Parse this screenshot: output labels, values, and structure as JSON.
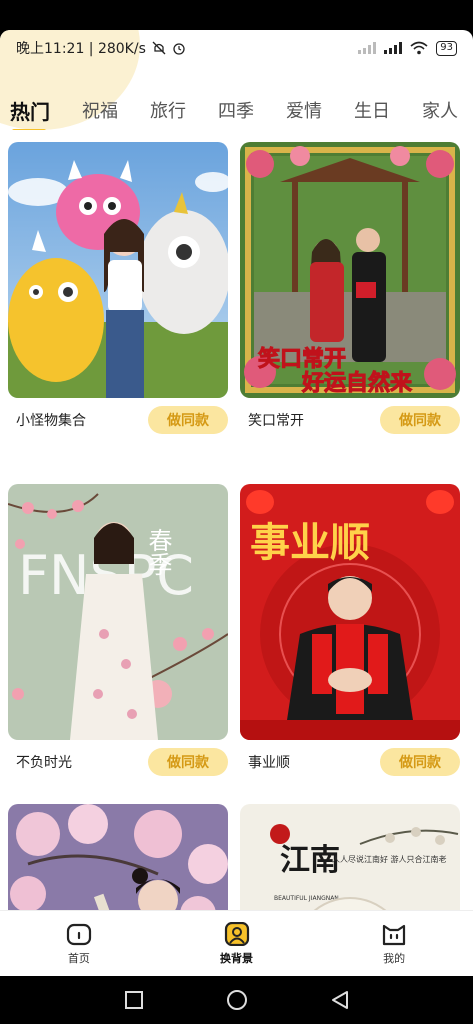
{
  "status_bar": {
    "time_speed": "晚上11:21 | 280K/s",
    "battery": "93"
  },
  "tabs": [
    {
      "label": "热门",
      "active": true
    },
    {
      "label": "祝福",
      "active": false
    },
    {
      "label": "旅行",
      "active": false
    },
    {
      "label": "四季",
      "active": false
    },
    {
      "label": "爱情",
      "active": false
    },
    {
      "label": "生日",
      "active": false
    },
    {
      "label": "家人",
      "active": false
    }
  ],
  "cards": [
    {
      "title": "小怪物集合",
      "button": "做同款"
    },
    {
      "title": "笑口常开",
      "button": "做同款",
      "overlay_line1": "笑口常开",
      "overlay_line2": "好运自然来"
    },
    {
      "title": "不负时光",
      "button": "做同款",
      "overlay_big": "FNSPC",
      "overlay_cn": "春季"
    },
    {
      "title": "事业顺",
      "button": "做同款",
      "overlay_big": "事业顺"
    },
    {
      "title": "",
      "button": ""
    },
    {
      "title": "",
      "button": "",
      "overlay_big": "江南",
      "overlay_small": "人人尽说江南好 游人只合江南老",
      "overlay_en": "BEAUTIFUL JIANGNAN"
    }
  ],
  "bottom_nav": [
    {
      "label": "首页",
      "icon": "home-icon",
      "active": false
    },
    {
      "label": "换背景",
      "icon": "portrait-icon",
      "active": true
    },
    {
      "label": "我的",
      "icon": "cat-face-icon",
      "active": false
    }
  ],
  "colors": {
    "accent": "#f6c12a",
    "button_bg": "#fbe6a0",
    "button_text": "#d59a16"
  }
}
